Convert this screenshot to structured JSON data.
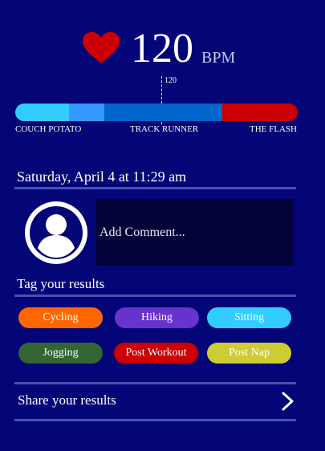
{
  "heart_rate": {
    "value": "120",
    "unit": "BPM",
    "marker_label": "120"
  },
  "range": {
    "labels": [
      "COUCH POTATO",
      "TRACK RUNNER",
      "THE FLASH"
    ],
    "colors": [
      "#33ccff",
      "#3399ff",
      "#0066cc",
      "#cc0000"
    ]
  },
  "date_text": "Saturday, April 4 at 11:29 am",
  "comment": {
    "placeholder": "Add Comment...",
    "value": ""
  },
  "tags": {
    "heading": "Tag your results",
    "items": [
      {
        "label": "Cycling",
        "color": "#ff6600"
      },
      {
        "label": "Hiking",
        "color": "#6633cc"
      },
      {
        "label": "Sitting",
        "color": "#33ccff"
      },
      {
        "label": "Jogging",
        "color": "#336633"
      },
      {
        "label": "Post Workout",
        "color": "#cc0000"
      },
      {
        "label": "Post Nap",
        "color": "#cccc33"
      }
    ]
  },
  "share": {
    "label": "Share your results"
  },
  "icons": {
    "heart": "heart-icon",
    "avatar": "user-avatar-icon",
    "chevron": "chevron-right-icon"
  },
  "colors": {
    "background": "#040576",
    "heart": "#cc0000",
    "divider": "#4a4fb0"
  }
}
